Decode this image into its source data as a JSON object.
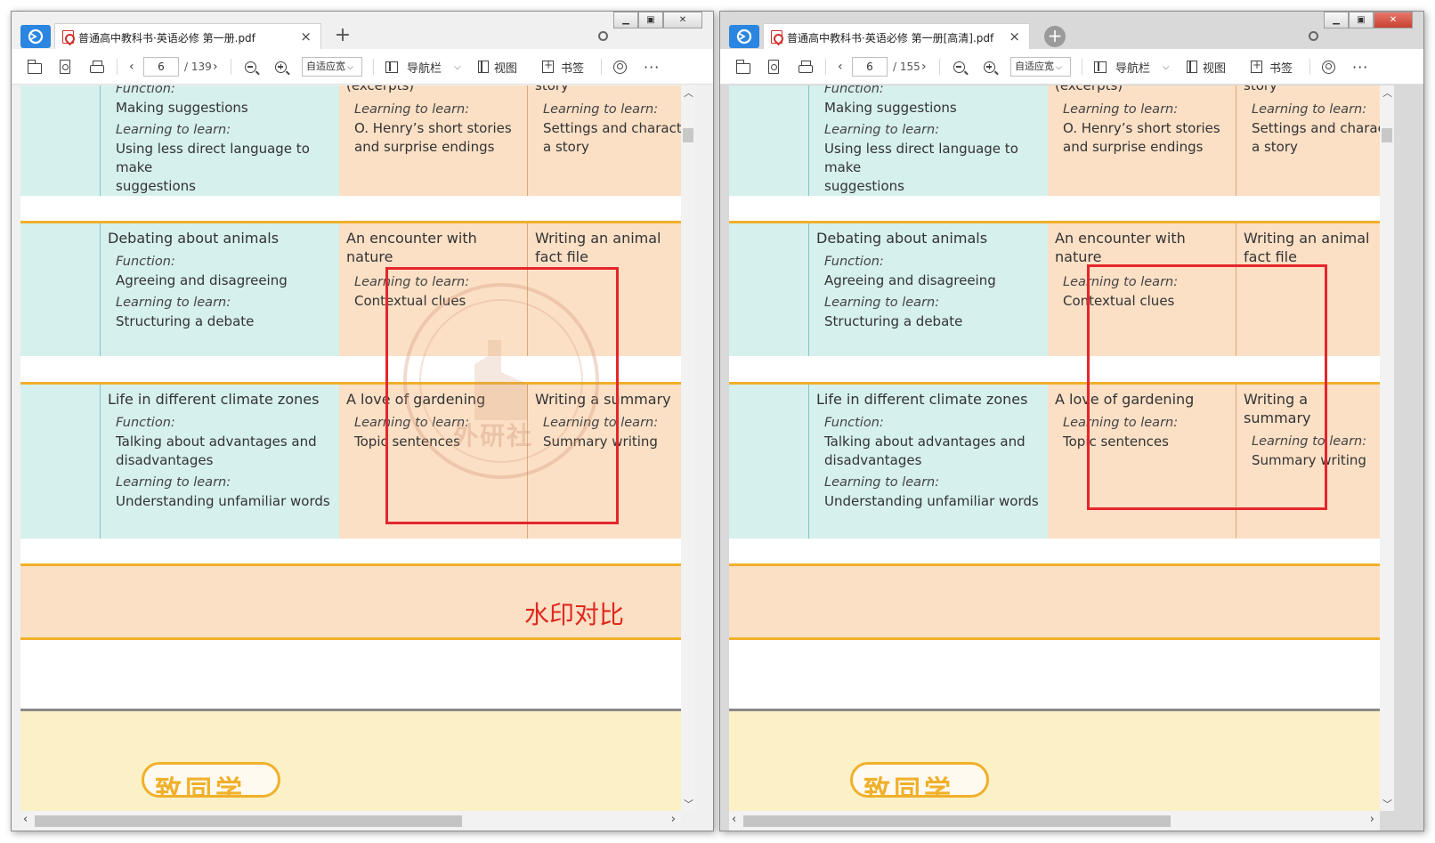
{
  "colors": {
    "teal": "#d6f0ee",
    "peach": "#fbe0c6",
    "gold": "#f0b02a",
    "red_annotation": "#e5262b",
    "yellow_band": "#fbf0c6"
  },
  "windows": [
    {
      "tab_title": "普通高中教科书·英语必修  第一册.pdf",
      "tab_close": "×",
      "new_tab": "+",
      "toolbar": {
        "page_current": "6",
        "page_total": "/ 139",
        "zoom_value": "自适应宽",
        "nav_label": "导航栏",
        "view_label": "视图",
        "bookmark_label": "书签",
        "more": "···"
      }
    },
    {
      "tab_title": "普通高中教科书·英语必修  第一册[高清].pdf",
      "tab_close": "×",
      "new_tab": "+",
      "toolbar": {
        "page_current": "6",
        "page_total": "/ 155",
        "zoom_value": "自适应宽",
        "nav_label": "导航栏",
        "view_label": "视图",
        "bookmark_label": "书签",
        "more": "···"
      }
    }
  ],
  "table": {
    "row1": {
      "col_b": {
        "function_label": "Function:",
        "function_value": "Making suggestions",
        "learn_label": "Learning to learn:",
        "learn_value_1": "Using less direct language to make",
        "learn_value_2": "suggestions"
      },
      "col_c": {
        "top_text": "(excerpts)",
        "learn_label": "Learning to learn:",
        "learn_value_1": "O. Henry’s short stories",
        "learn_value_2": "and surprise endings"
      },
      "col_d": {
        "top_text": "story",
        "learn_label": "Learning to learn:",
        "learn_value_1": "Settings and characters in",
        "learn_value_2": "a story"
      }
    },
    "row2": {
      "col_b": {
        "title": "Debating about animals",
        "function_label": "Function:",
        "function_value": "Agreeing and disagreeing",
        "learn_label": "Learning to learn:",
        "learn_value": "Structuring a debate"
      },
      "col_c": {
        "title_1": "An encounter with",
        "title_2": "nature",
        "learn_label": "Learning to learn:",
        "learn_value": "Contextual clues"
      },
      "col_d": {
        "title_1": "Writing an animal",
        "title_2": "fact file"
      }
    },
    "row3": {
      "col_b": {
        "title": "Life in different climate zones",
        "function_label": "Function:",
        "function_value_1": "Talking about advantages and",
        "function_value_2": "disadvantages",
        "learn_label": "Learning to learn:",
        "learn_value": "Understanding unfamiliar words"
      },
      "col_c": {
        "title": "A love of gardening",
        "learn_label": "Learning to learn:",
        "learn_value": "Topic sentences"
      },
      "col_d": {
        "title": "Writing a summary",
        "learn_label": "Learning to learn:",
        "learn_value": "Summary writing"
      }
    }
  },
  "annotation_text": "水印对比",
  "watermark_text": "外研社",
  "bottom_pill_text": "致同学"
}
